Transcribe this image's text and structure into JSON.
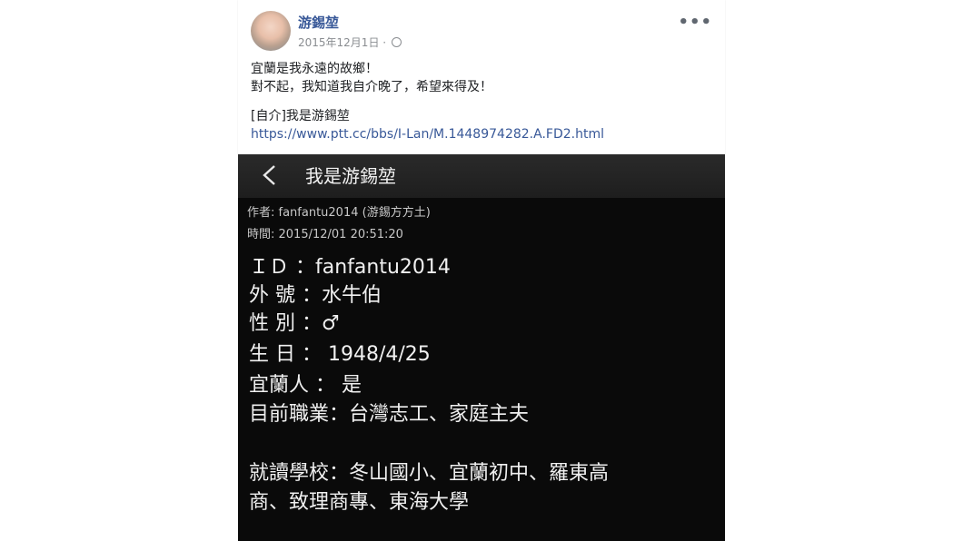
{
  "post": {
    "author": "游錫堃",
    "date": "2015年12月1日",
    "separator": "·",
    "more_label": "•••",
    "text_lines": [
      "宜蘭是我永遠的故鄉！",
      "對不起，我知道我自介晚了，希望來得及！"
    ],
    "shared_title": "[自介]我是游錫堃",
    "shared_url": "https://www.ptt.cc/bbs/I-Lan/M.1448974282.A.FD2.html"
  },
  "screenshot": {
    "title": "我是游錫堃",
    "author_line": "作者: fanfantu2014 (游錫方方土)",
    "time_line": "時間: 2015/12/01 20:51:20",
    "profile_lines": [
      "ＩＤ ：fanfantu2014",
      "外 號 ：水牛伯",
      "性 別 ：♂",
      "生 日 ： 1948/4/25",
      " 宜蘭人 ： 是",
      "目前職業：台灣志工、家庭主夫",
      "就讀學校：冬山國小、宜蘭初中、羅東高",
      "商、致理商專、東海大學"
    ]
  },
  "icons": {
    "avatar": "baby-avatar",
    "globe": "globe-icon",
    "more": "more-options-icon",
    "back": "chevron-left-icon"
  },
  "colors": {
    "author_link": "#385898",
    "meta_gray": "#8a8d91",
    "screenshot_bg": "#0a0a0a"
  }
}
